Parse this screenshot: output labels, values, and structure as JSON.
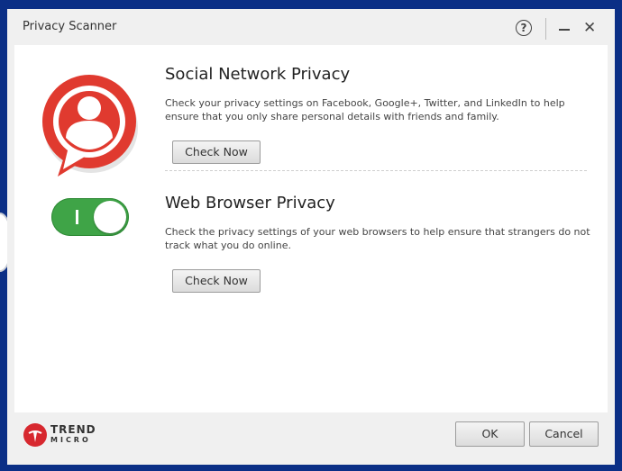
{
  "window": {
    "title": "Privacy Scanner",
    "help_label": "?",
    "close_label": "✕"
  },
  "sections": [
    {
      "title": "Social Network Privacy",
      "description": "Check your privacy settings on Facebook, Google+, Twitter, and LinkedIn to help ensure that you only share personal details with friends and family.",
      "button_label": "Check Now",
      "icon": "social-privacy-icon"
    },
    {
      "title": "Web Browser Privacy",
      "description": "Check the privacy settings of your web browsers to help ensure that strangers do not track what you do online.",
      "button_label": "Check Now",
      "toggle_state": "on"
    }
  ],
  "footer": {
    "logo_line1": "TREND",
    "logo_line2": "MICRO",
    "ok_label": "OK",
    "cancel_label": "Cancel"
  },
  "colors": {
    "desktop": "#0b2f86",
    "accent_red": "#e03a2f",
    "toggle_green": "#3fa447"
  }
}
